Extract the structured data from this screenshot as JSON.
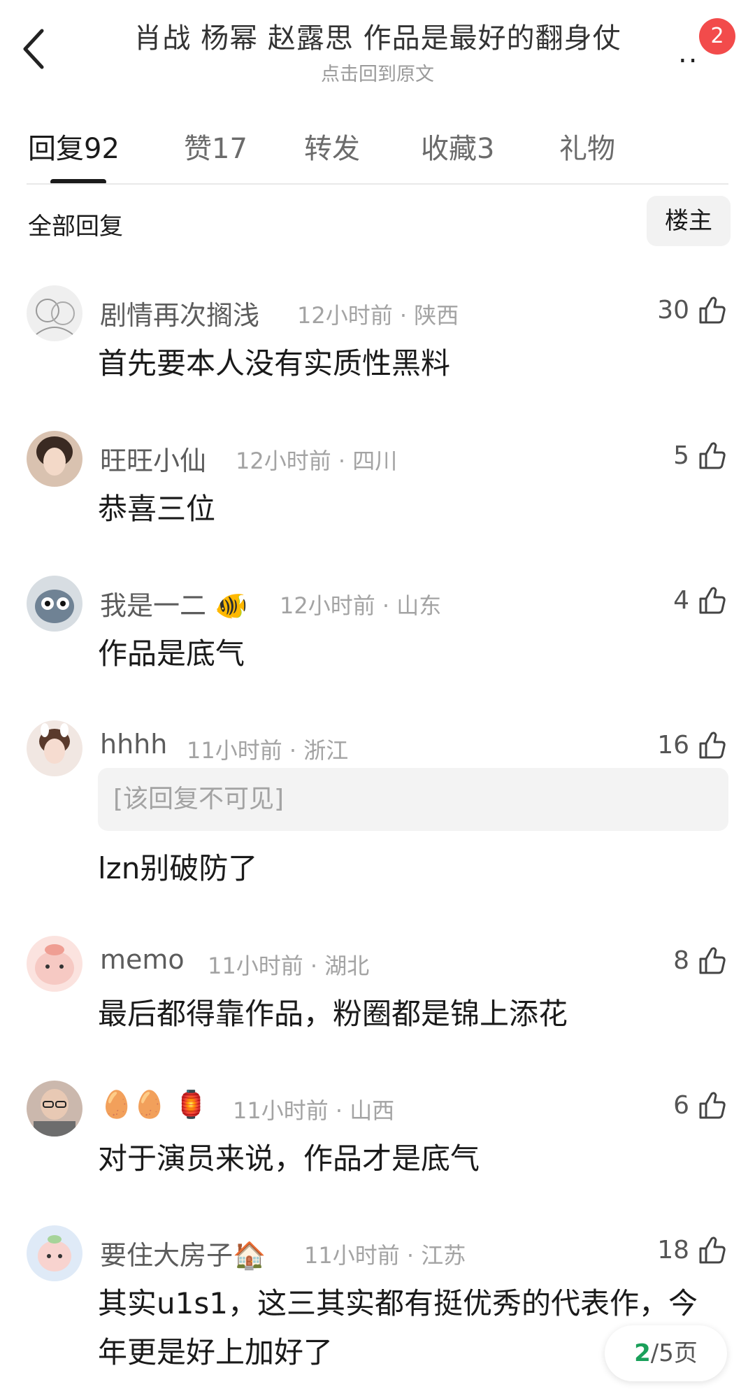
{
  "header": {
    "title": "肖战 杨幂 赵露思 作品是最好的翻身仗",
    "subtitle": "点击回到原文",
    "more_label": "..",
    "badge_count": "2"
  },
  "tabs": [
    {
      "label": "回复92",
      "active": true
    },
    {
      "label": "赞17"
    },
    {
      "label": "转发"
    },
    {
      "label": "收藏3"
    },
    {
      "label": "礼物"
    }
  ],
  "filter": {
    "label": "全部回复",
    "op_button": "楼主"
  },
  "comments": [
    {
      "name": "剧情再次搁浅",
      "time": "12小时前",
      "region": "陕西",
      "likes": "30",
      "body": "首先要本人没有实质性黑料",
      "avatar_color": "#dcdcdc"
    },
    {
      "name": "旺旺小仙",
      "time": "12小时前",
      "region": "四川",
      "likes": "5",
      "body": "恭喜三位",
      "avatar_color": "#c9a48a"
    },
    {
      "name": "我是一二",
      "name_emoji": "🐠",
      "time": "12小时前",
      "region": "山东",
      "likes": "4",
      "body": "作品是底气",
      "avatar_color": "#7f8e9c"
    },
    {
      "name": "hhhh",
      "time": "11小时前",
      "region": "浙江",
      "likes": "16",
      "hidden_reply": "[该回复不可见]",
      "body": "lzn别破防了",
      "avatar_color": "#e9d6cc"
    },
    {
      "name": "memo",
      "time": "11小时前",
      "region": "湖北",
      "likes": "8",
      "body": "最后都得靠作品，粉圈都是锦上添花",
      "avatar_color": "#f6c9c3"
    },
    {
      "name": "🥚🥚 🏮",
      "time": "11小时前",
      "region": "山西",
      "likes": "6",
      "body": "对于演员来说，作品才是底气",
      "avatar_color": "#b8a49a"
    },
    {
      "name": "要住大房子🏠",
      "time": "11小时前",
      "region": "江苏",
      "likes": "18",
      "body": "其实u1s1，这三其实都有挺优秀的代表作，今",
      "body2": "年更是好上加好了",
      "avatar_color": "#d8e4f4"
    }
  ],
  "pager": {
    "current": "2",
    "total_text": "/5页"
  },
  "colors": {
    "badge": "#f24b4b",
    "pager_current": "#1aa05a"
  }
}
